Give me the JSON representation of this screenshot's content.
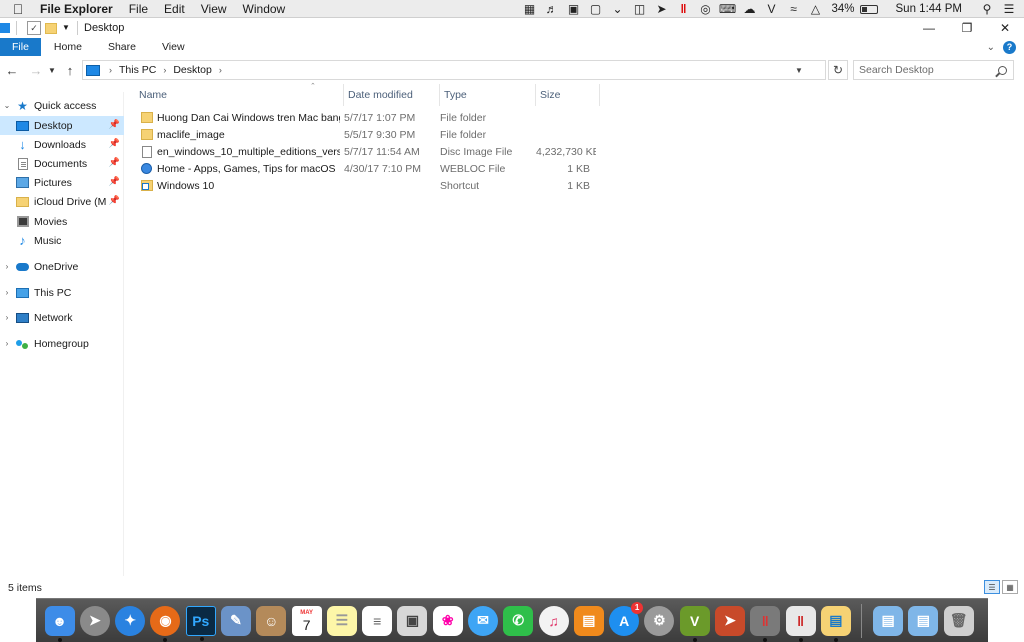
{
  "menubar": {
    "app_name": "File Explorer",
    "menus": [
      "File",
      "Edit",
      "View",
      "Window"
    ],
    "battery": "34%",
    "clock": "Sun 1:44 PM"
  },
  "window": {
    "title": "Desktop",
    "controls": {
      "minimize": "—",
      "restore": "❐",
      "close": "✕"
    }
  },
  "ribbon": {
    "tabs": [
      "File",
      "Home",
      "Share",
      "View"
    ],
    "help": "?"
  },
  "address": {
    "crumbs": [
      "This PC",
      "Desktop"
    ],
    "search_placeholder": "Search Desktop"
  },
  "navpane": {
    "items": [
      {
        "label": "Quick access",
        "icon": "star-icon"
      },
      {
        "label": "Desktop",
        "icon": "desktop-icon",
        "pinned": true,
        "selected": true
      },
      {
        "label": "Downloads",
        "icon": "download-icon",
        "pinned": true
      },
      {
        "label": "Documents",
        "icon": "document-icon",
        "pinned": true
      },
      {
        "label": "Pictures",
        "icon": "pictures-icon",
        "pinned": true
      },
      {
        "label": "iCloud Drive (Ma",
        "icon": "folder-icon",
        "pinned": true
      },
      {
        "label": "Movies",
        "icon": "movie-icon"
      },
      {
        "label": "Music",
        "icon": "music-icon"
      },
      {
        "label": "OneDrive",
        "icon": "cloud-icon"
      },
      {
        "label": "This PC",
        "icon": "computer-icon"
      },
      {
        "label": "Network",
        "icon": "network-icon"
      },
      {
        "label": "Homegroup",
        "icon": "homegroup-icon"
      }
    ]
  },
  "files": {
    "columns": [
      "Name",
      "Date modified",
      "Type",
      "Size"
    ],
    "rows": [
      {
        "name": "Huong Dan Cai Windows tren Mac bang ...",
        "date": "5/7/17 1:07 PM",
        "type": "File folder",
        "size": "",
        "icon": "folder-icon"
      },
      {
        "name": "maclife_image",
        "date": "5/5/17 9:30 PM",
        "type": "File folder",
        "size": "",
        "icon": "folder-icon"
      },
      {
        "name": "en_windows_10_multiple_editions_versio...",
        "date": "5/7/17 11:54 AM",
        "type": "Disc Image File",
        "size": "4,232,730 KB",
        "icon": "disc-image-icon"
      },
      {
        "name": "Home - Apps, Games, Tips for macOS",
        "date": "4/30/17 7:10 PM",
        "type": "WEBLOC File",
        "size": "1 KB",
        "icon": "webloc-icon"
      },
      {
        "name": "Windows 10",
        "date": "",
        "type": "Shortcut",
        "size": "1 KB",
        "icon": "shortcut-icon"
      }
    ]
  },
  "status": {
    "items_count": "5 items"
  },
  "dock": {
    "calendar_month": "MAY",
    "calendar_day": "7",
    "appstore_badge": "1",
    "ps_label": "Ps",
    "vmware_label": "V",
    "colors": {
      "finder": "#3d8ce8",
      "launchpad": "#8a8a8a",
      "safari": "#2a82e0",
      "firefox": "#e66a18",
      "photoshop": "#0a2a44"
    }
  }
}
